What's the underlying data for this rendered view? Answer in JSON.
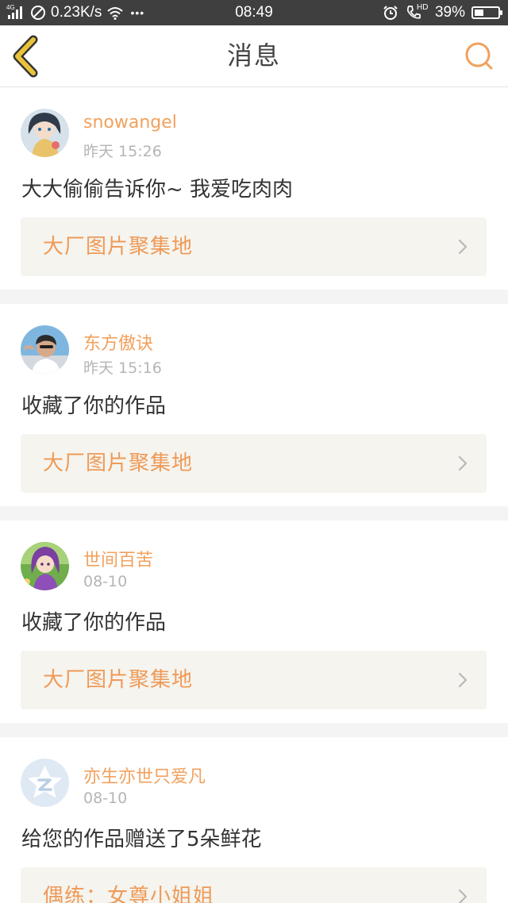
{
  "status_bar": {
    "network_type": "4G",
    "speed": "0.23K/s",
    "dots": "•••",
    "time": "08:49",
    "hd_label": "HD",
    "battery": "39%",
    "battery_level": 0.39
  },
  "header": {
    "title": "消息",
    "back_icon": "chevron-left-icon",
    "search_icon": "search-icon"
  },
  "colors": {
    "accent": "#f1a15d",
    "back_arrow": "#e8c33a",
    "status_bar_bg": "#3f3f3f"
  },
  "messages": [
    {
      "username": "snowangel",
      "time": "昨天 15:26",
      "text": "大大偷偷告诉你~ 我爱吃肉肉",
      "work_title": "大厂图片聚集地",
      "avatar_icon": "anime-avatar"
    },
    {
      "username": "东方傲诀",
      "time": "昨天 15:16",
      "text": "收藏了你的作品",
      "work_title": "大厂图片聚集地",
      "avatar_icon": "photo-avatar"
    },
    {
      "username": "世间百苦",
      "time": "08-10",
      "text": "收藏了你的作品",
      "work_title": "大厂图片聚集地",
      "avatar_icon": "anime-avatar"
    },
    {
      "username": "亦生亦世只爱凡",
      "time": "08-10",
      "text": "给您的作品赠送了5朵鲜花",
      "work_title": "偶练：女尊小姐姐",
      "avatar_icon": "default-avatar"
    }
  ]
}
